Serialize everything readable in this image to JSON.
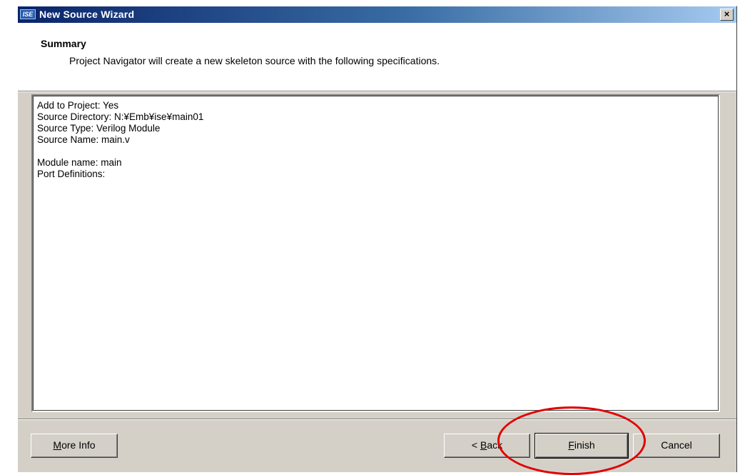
{
  "window": {
    "title": "New Source Wizard",
    "app_icon_text": "ISE",
    "close_label": "×"
  },
  "header": {
    "title": "Summary",
    "description": "Project Navigator will create a new skeleton source with the following specifications."
  },
  "summary": {
    "lines": [
      "Add to Project: Yes",
      "Source Directory: N:¥Emb¥ise¥main01",
      "Source Type: Verilog Module",
      "Source Name: main.v",
      "",
      "Module name: main",
      "Port Definitions:"
    ]
  },
  "buttons": {
    "more_info": {
      "mnemonic": "M",
      "rest": "ore Info"
    },
    "back": {
      "prefix": "< ",
      "mnemonic": "B",
      "rest": "ack"
    },
    "finish": {
      "mnemonic": "F",
      "rest": "inish"
    },
    "cancel": {
      "label": "Cancel"
    }
  },
  "annotation": {
    "color": "#e00000",
    "target": "finish"
  }
}
